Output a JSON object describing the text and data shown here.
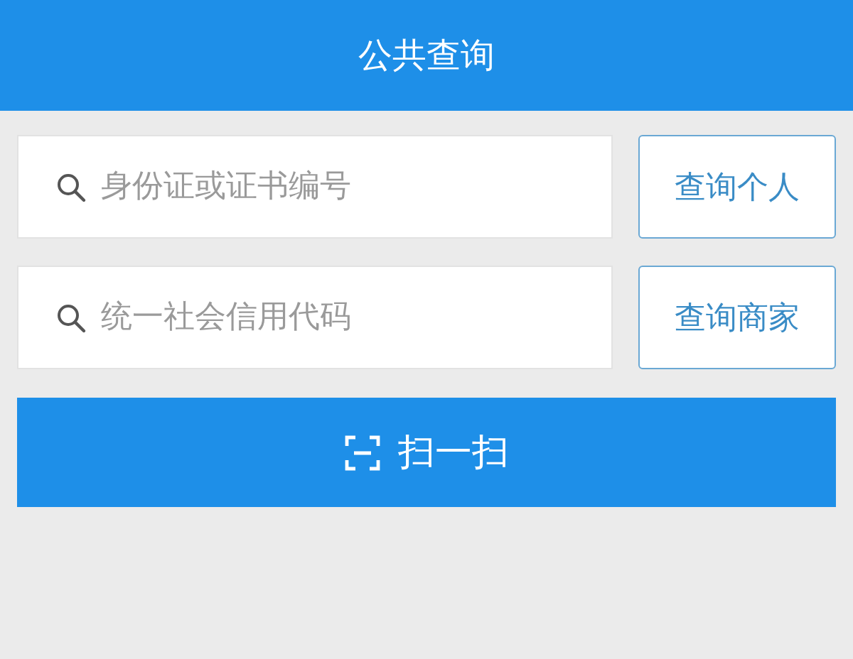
{
  "header": {
    "title": "公共查询"
  },
  "queries": [
    {
      "placeholder": "身份证或证书编号",
      "button": "查询个人"
    },
    {
      "placeholder": "统一社会信用代码",
      "button": "查询商家"
    }
  ],
  "scan_button": {
    "label": "扫一扫"
  }
}
